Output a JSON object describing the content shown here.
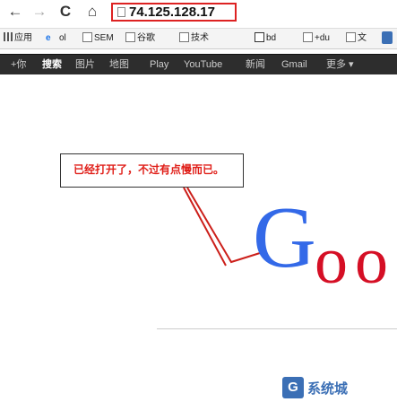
{
  "toolbar": {
    "back_icon": "←",
    "forward_icon": "→",
    "reload_icon": "C",
    "home_icon": "⌂",
    "address_url": "74.125.128.17"
  },
  "bookmarks": [
    {
      "label": "应用",
      "icon": "apps-grid-icon"
    },
    {
      "label": "e",
      "icon": "ie-icon"
    },
    {
      "label": "ol",
      "icon": ""
    },
    {
      "label": "SEM",
      "icon": "page-icon"
    },
    {
      "label": "谷歌",
      "icon": "page-icon"
    },
    {
      "label": "技术",
      "icon": "page-icon"
    },
    {
      "label": "bd",
      "icon": "page-icon"
    },
    {
      "label": "+du",
      "icon": "page-icon"
    },
    {
      "label": "文",
      "icon": "page-icon"
    }
  ],
  "google_bar": {
    "items": [
      "+你",
      "搜索",
      "图片",
      "地图",
      "Play",
      "YouTube",
      "新闻",
      "Gmail",
      "更多 ▾"
    ],
    "active_index": 1
  },
  "callout": {
    "text": "已经打开了，不过有点慢而已。",
    "color": "#e0201a"
  },
  "logo": {
    "letters": [
      "G",
      "o",
      "o"
    ],
    "colors": [
      "#3369e8",
      "#d50f25",
      "#d50f25"
    ]
  },
  "watermark": {
    "icon_letter": "G",
    "text": "系统城"
  }
}
